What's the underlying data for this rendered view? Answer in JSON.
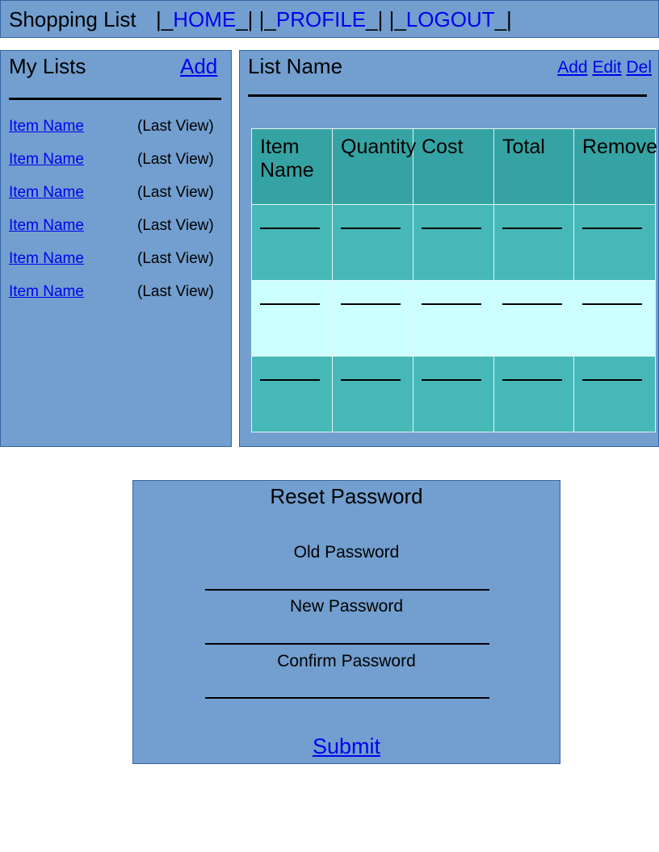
{
  "topbar": {
    "title": "Shopping List",
    "nav": [
      {
        "pre": "|_",
        "label": "HOME",
        "post": "_|"
      },
      {
        "pre": " |_",
        "label": "PROFILE",
        "post": "_|"
      },
      {
        "pre": " |_",
        "label": "LOGOUT",
        "post": "_|"
      }
    ]
  },
  "my_lists": {
    "title": "My Lists",
    "add_label": "Add",
    "items": [
      {
        "name": "Item Name",
        "meta": "(Last View)"
      },
      {
        "name": "Item Name",
        "meta": "(Last View)"
      },
      {
        "name": "Item Name",
        "meta": "(Last View)"
      },
      {
        "name": "Item Name",
        "meta": "(Last View)"
      },
      {
        "name": "Item Name",
        "meta": "(Last View)"
      },
      {
        "name": "Item Name",
        "meta": "(Last View)"
      }
    ]
  },
  "list": {
    "title": "List Name",
    "actions": [
      "Add",
      "Edit",
      "Del"
    ],
    "table": {
      "headers": [
        "Item Name",
        "Quantity",
        "Cost",
        "Total",
        "Remove"
      ],
      "rows": [
        [
          "",
          "",
          "",
          "",
          ""
        ],
        [
          "",
          "",
          "",
          "",
          ""
        ],
        [
          "",
          "",
          "",
          "",
          ""
        ]
      ]
    }
  },
  "reset_password": {
    "title": "Reset Password",
    "fields": [
      {
        "label": "Old Password",
        "value": ""
      },
      {
        "label": "New Password",
        "value": ""
      },
      {
        "label": "Confirm Password",
        "value": ""
      }
    ],
    "submit_label": "Submit"
  },
  "colors": {
    "panel": "#729fcf",
    "panel_border": "#3465a4",
    "header_cell": "#35a3a3",
    "row_dark": "#46b8b8",
    "row_light": "#ccffff",
    "link": "#0000ee"
  }
}
